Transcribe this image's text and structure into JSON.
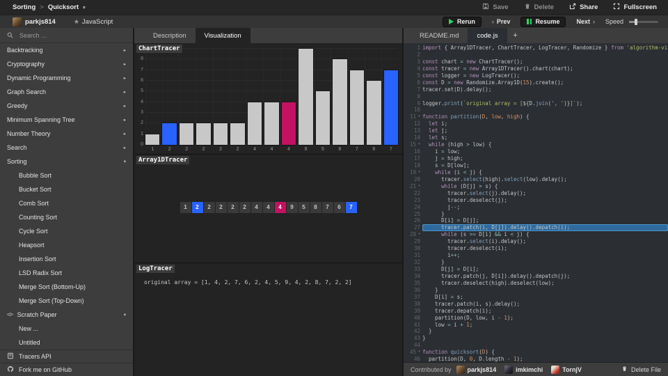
{
  "header": {
    "breadcrumb": {
      "category": "Sorting",
      "separator": ">",
      "title": "Quicksort",
      "caret": "▾"
    },
    "actions": {
      "save": "Save",
      "delete": "Delete",
      "share": "Share",
      "fullscreen": "Fullscreen"
    }
  },
  "toolbar": {
    "author": "parkjs814",
    "language": "JavaScript",
    "star": "★",
    "rerun": "Rerun",
    "prev": "Prev",
    "resume": "Resume",
    "next": "Next",
    "prev_chevron": "‹",
    "next_chevron": "›",
    "speed_label": "Speed"
  },
  "sidebar": {
    "search_placeholder": "Search ...",
    "collapse_arrow": "▸",
    "expand_arrow": "▾",
    "code_icon": "</>",
    "categories": [
      "Backtracking",
      "Cryptography",
      "Dynamic Programming",
      "Graph Search",
      "Greedy",
      "Minimum Spanning Tree",
      "Number Theory",
      "Search"
    ],
    "sorting": {
      "label": "Sorting",
      "items": [
        "Bubble Sort",
        "Bucket Sort",
        "Comb Sort",
        "Counting Sort",
        "Cycle Sort",
        "Heapsort",
        "Insertion Sort",
        "LSD Radix Sort",
        "Merge Sort (Bottom-Up)",
        "Merge Sort (Top-Down)"
      ]
    },
    "scratch": {
      "label": "Scratch Paper",
      "items": [
        "New ...",
        "Untitled"
      ]
    },
    "footer_items": [
      "Tracers API",
      "Fork me on GitHub"
    ]
  },
  "viz": {
    "tabs": [
      "Description",
      "Visualization"
    ],
    "active_tab": "Visualization",
    "chart_title": "ChartTracer",
    "array_title": "Array1DTracer",
    "log_title": "LogTracer",
    "array_values": [
      1,
      2,
      2,
      2,
      2,
      2,
      4,
      4,
      4,
      9,
      5,
      8,
      7,
      6,
      7
    ],
    "selected_indices": [
      1,
      14
    ],
    "patched_indices": [
      8
    ],
    "log_lines": [
      "original array = [1, 4, 2, 7, 6, 2, 4, 5, 9, 4, 2, 8, 7, 2, 2]"
    ]
  },
  "chart_data": {
    "type": "bar",
    "title": "ChartTracer",
    "categories": [
      "1",
      "2",
      "2",
      "2",
      "2",
      "2",
      "4",
      "4",
      "4",
      "9",
      "5",
      "8",
      "7",
      "6",
      "7"
    ],
    "values": [
      1,
      2,
      2,
      2,
      2,
      2,
      4,
      4,
      4,
      9,
      5,
      8,
      7,
      6,
      7
    ],
    "ylim": [
      0,
      9
    ],
    "yticks": [
      0,
      1,
      2,
      3,
      4,
      5,
      6,
      7,
      8,
      9
    ],
    "grid": true,
    "legend": false,
    "bar_color": "#c8c8c8",
    "selected_indices": [
      1,
      14
    ],
    "selected_color": "#2962ff",
    "patched_indices": [
      8
    ],
    "patched_color": "#c51162"
  },
  "editor": {
    "tabs": [
      "README.md",
      "code.js"
    ],
    "active_tab": "code.js",
    "new_tab_label": "+",
    "highlight_line": 27,
    "fold_lines": [
      11,
      15,
      19,
      21,
      28,
      45
    ],
    "lines": [
      {
        "n": 1,
        "t": [
          [
            "import",
            "k"
          ],
          [
            " { Array1DTracer, ChartTracer, LogTracer, Randomize } ",
            "p"
          ],
          [
            "from",
            "k"
          ],
          [
            " ",
            "p"
          ],
          [
            "'algorithm-visualizer';",
            "s"
          ]
        ]
      },
      {
        "n": 2,
        "t": []
      },
      {
        "n": 3,
        "t": [
          [
            "const",
            "k"
          ],
          [
            " chart ",
            "p"
          ],
          [
            "=",
            "o"
          ],
          [
            " ",
            "p"
          ],
          [
            "new",
            "k"
          ],
          [
            " ChartTracer();",
            "p"
          ]
        ]
      },
      {
        "n": 4,
        "t": [
          [
            "const",
            "k"
          ],
          [
            " tracer ",
            "p"
          ],
          [
            "=",
            "o"
          ],
          [
            " ",
            "p"
          ],
          [
            "new",
            "k"
          ],
          [
            " Array1DTracer().chart(chart);",
            "p"
          ]
        ]
      },
      {
        "n": 5,
        "t": [
          [
            "const",
            "k"
          ],
          [
            " logger ",
            "p"
          ],
          [
            "=",
            "o"
          ],
          [
            " ",
            "p"
          ],
          [
            "new",
            "k"
          ],
          [
            " LogTracer();",
            "p"
          ]
        ]
      },
      {
        "n": 6,
        "t": [
          [
            "const",
            "k"
          ],
          [
            " D ",
            "p"
          ],
          [
            "=",
            "o"
          ],
          [
            " ",
            "p"
          ],
          [
            "new",
            "k"
          ],
          [
            " Randomize.Array1D(",
            "p"
          ],
          [
            "15",
            "n"
          ],
          [
            ").create();",
            "p"
          ]
        ]
      },
      {
        "n": 7,
        "t": [
          [
            "tracer.set(D).delay();",
            "p"
          ]
        ]
      },
      {
        "n": 8,
        "t": []
      },
      {
        "n": 9,
        "t": [
          [
            "logger.",
            "p"
          ],
          [
            "print",
            "f"
          ],
          [
            "(",
            "p"
          ],
          [
            "`original array = [",
            "s"
          ],
          [
            "${",
            "p"
          ],
          [
            "D.",
            "p"
          ],
          [
            "join",
            "f"
          ],
          [
            "(",
            "p"
          ],
          [
            "', '",
            "s"
          ],
          [
            ")}",
            "p"
          ],
          [
            "]`",
            "s"
          ],
          [
            ");",
            "p"
          ]
        ]
      },
      {
        "n": 10,
        "t": []
      },
      {
        "n": 11,
        "t": [
          [
            "function",
            "k"
          ],
          [
            " ",
            "p"
          ],
          [
            "partition",
            "f"
          ],
          [
            "(",
            "p"
          ],
          [
            "D",
            "v"
          ],
          [
            ", ",
            "p"
          ],
          [
            "low",
            "v"
          ],
          [
            ", ",
            "p"
          ],
          [
            "high",
            "v"
          ],
          [
            ") {",
            "p"
          ]
        ]
      },
      {
        "n": 12,
        "t": [
          [
            "  ",
            "p"
          ],
          [
            "let",
            "k"
          ],
          [
            " i;",
            "p"
          ]
        ]
      },
      {
        "n": 13,
        "t": [
          [
            "  ",
            "p"
          ],
          [
            "let",
            "k"
          ],
          [
            " j;",
            "p"
          ]
        ]
      },
      {
        "n": 14,
        "t": [
          [
            "  ",
            "p"
          ],
          [
            "let",
            "k"
          ],
          [
            " s;",
            "p"
          ]
        ]
      },
      {
        "n": 15,
        "t": [
          [
            "  ",
            "p"
          ],
          [
            "while",
            "k"
          ],
          [
            " (high ",
            "p"
          ],
          [
            ">",
            "o"
          ],
          [
            " low) {",
            "p"
          ]
        ]
      },
      {
        "n": 16,
        "t": [
          [
            "    i ",
            "p"
          ],
          [
            "=",
            "o"
          ],
          [
            " low;",
            "p"
          ]
        ]
      },
      {
        "n": 17,
        "t": [
          [
            "    j ",
            "p"
          ],
          [
            "=",
            "o"
          ],
          [
            " high;",
            "p"
          ]
        ]
      },
      {
        "n": 18,
        "t": [
          [
            "    s ",
            "p"
          ],
          [
            "=",
            "o"
          ],
          [
            " D[low];",
            "p"
          ]
        ]
      },
      {
        "n": 19,
        "t": [
          [
            "    ",
            "p"
          ],
          [
            "while",
            "k"
          ],
          [
            " (i ",
            "p"
          ],
          [
            "<",
            "o"
          ],
          [
            " j) {",
            "p"
          ]
        ]
      },
      {
        "n": 20,
        "t": [
          [
            "      tracer.",
            "p"
          ],
          [
            "select",
            "f"
          ],
          [
            "(high).",
            "p"
          ],
          [
            "select",
            "f"
          ],
          [
            "(low).delay();",
            "p"
          ]
        ]
      },
      {
        "n": 21,
        "t": [
          [
            "      ",
            "p"
          ],
          [
            "while",
            "k"
          ],
          [
            " (D[j] ",
            "p"
          ],
          [
            ">",
            "o"
          ],
          [
            " s) {",
            "p"
          ]
        ]
      },
      {
        "n": 22,
        "t": [
          [
            "        tracer.",
            "p"
          ],
          [
            "select",
            "f"
          ],
          [
            "(j).delay();",
            "p"
          ]
        ]
      },
      {
        "n": 23,
        "t": [
          [
            "        tracer.deselect(j);",
            "p"
          ]
        ]
      },
      {
        "n": 24,
        "t": [
          [
            "        j",
            "p"
          ],
          [
            "--",
            "o"
          ],
          [
            ";",
            "p"
          ]
        ]
      },
      {
        "n": 25,
        "t": [
          [
            "      }",
            "p"
          ]
        ]
      },
      {
        "n": 26,
        "t": [
          [
            "      D[i] ",
            "p"
          ],
          [
            "=",
            "o"
          ],
          [
            " D[j];",
            "p"
          ]
        ]
      },
      {
        "n": 27,
        "t": [
          [
            "      tracer.patch(i, D[j]).delay().depatch(i);",
            "p"
          ]
        ]
      },
      {
        "n": 28,
        "t": [
          [
            "      ",
            "p"
          ],
          [
            "while",
            "k"
          ],
          [
            " (s ",
            "p"
          ],
          [
            ">=",
            "o"
          ],
          [
            " D[i] ",
            "p"
          ],
          [
            "&&",
            "o"
          ],
          [
            " i ",
            "p"
          ],
          [
            "<",
            "o"
          ],
          [
            " j) {",
            "p"
          ]
        ]
      },
      {
        "n": 29,
        "t": [
          [
            "        tracer.",
            "p"
          ],
          [
            "select",
            "f"
          ],
          [
            "(i).delay();",
            "p"
          ]
        ]
      },
      {
        "n": 30,
        "t": [
          [
            "        tracer.deselect(i);",
            "p"
          ]
        ]
      },
      {
        "n": 31,
        "t": [
          [
            "        i",
            "p"
          ],
          [
            "++",
            "o"
          ],
          [
            ";",
            "p"
          ]
        ]
      },
      {
        "n": 32,
        "t": [
          [
            "      }",
            "p"
          ]
        ]
      },
      {
        "n": 33,
        "t": [
          [
            "      D[j] ",
            "p"
          ],
          [
            "=",
            "o"
          ],
          [
            " D[i];",
            "p"
          ]
        ]
      },
      {
        "n": 34,
        "t": [
          [
            "      tracer.patch(j, D[i]).delay().depatch(j);",
            "p"
          ]
        ]
      },
      {
        "n": 35,
        "t": [
          [
            "      tracer.deselect(high).deselect(low);",
            "p"
          ]
        ]
      },
      {
        "n": 36,
        "t": [
          [
            "    }",
            "p"
          ]
        ]
      },
      {
        "n": 37,
        "t": [
          [
            "    D[i] ",
            "p"
          ],
          [
            "=",
            "o"
          ],
          [
            " s;",
            "p"
          ]
        ]
      },
      {
        "n": 38,
        "t": [
          [
            "    tracer.patch(i, s).delay();",
            "p"
          ]
        ]
      },
      {
        "n": 39,
        "t": [
          [
            "    tracer.depatch(i);",
            "p"
          ]
        ]
      },
      {
        "n": 40,
        "t": [
          [
            "    partition(D, low, i ",
            "p"
          ],
          [
            "-",
            "o"
          ],
          [
            " ",
            "p"
          ],
          [
            "1",
            "n"
          ],
          [
            ");",
            "p"
          ]
        ]
      },
      {
        "n": 41,
        "t": [
          [
            "    low ",
            "p"
          ],
          [
            "=",
            "o"
          ],
          [
            " i ",
            "p"
          ],
          [
            "+",
            "o"
          ],
          [
            " ",
            "p"
          ],
          [
            "1",
            "n"
          ],
          [
            ";",
            "p"
          ]
        ]
      },
      {
        "n": 42,
        "t": [
          [
            "  }",
            "p"
          ]
        ]
      },
      {
        "n": 43,
        "t": [
          [
            "}",
            "p"
          ]
        ]
      },
      {
        "n": 44,
        "t": []
      },
      {
        "n": 45,
        "t": [
          [
            "function",
            "k"
          ],
          [
            " ",
            "p"
          ],
          [
            "quicksort",
            "f"
          ],
          [
            "(",
            "p"
          ],
          [
            "D",
            "v"
          ],
          [
            ") {",
            "p"
          ]
        ]
      },
      {
        "n": 46,
        "t": [
          [
            "  partition(D, ",
            "p"
          ],
          [
            "0",
            "n"
          ],
          [
            ", D.length ",
            "p"
          ],
          [
            "-",
            "o"
          ],
          [
            " ",
            "p"
          ],
          [
            "1",
            "n"
          ],
          [
            ");",
            "p"
          ]
        ]
      }
    ]
  },
  "footer": {
    "contributed_label": "Contributed by",
    "contributors": [
      "parkjs814",
      "imkimchi",
      "TornjV"
    ],
    "delete_file_label": "Delete File"
  },
  "colors": {
    "selected": "#2962ff",
    "patched": "#c51162",
    "bar": "#c8c8c8",
    "accent_green": "#2fd566"
  }
}
